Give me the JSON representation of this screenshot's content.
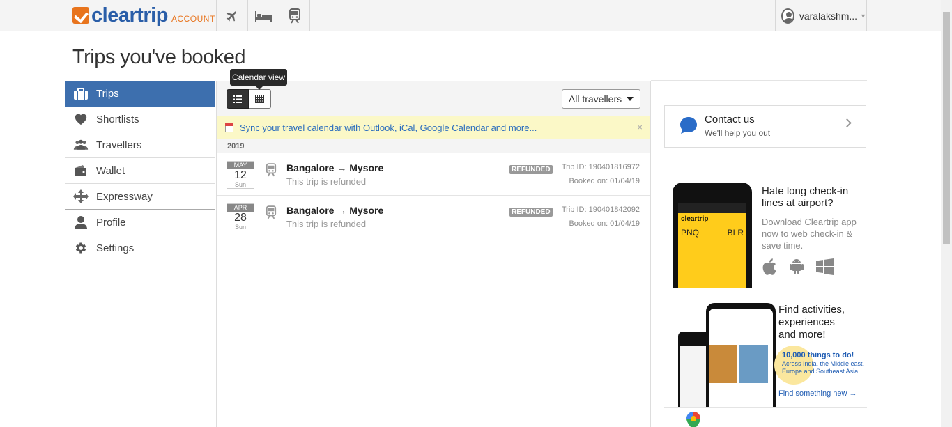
{
  "header": {
    "brand": "cleartrip",
    "brand_sub": "ACCOUNT",
    "nav": [
      {
        "icon": "airplane-icon"
      },
      {
        "icon": "bed-icon"
      },
      {
        "icon": "train-icon"
      }
    ],
    "user": "varalakshm..."
  },
  "page": {
    "title": "Trips you've booked"
  },
  "sidebar": {
    "items": [
      {
        "label": "Trips",
        "icon": "suitcase-icon"
      },
      {
        "label": "Shortlists",
        "icon": "heart-icon"
      },
      {
        "label": "Travellers",
        "icon": "people-icon"
      },
      {
        "label": "Wallet",
        "icon": "wallet-icon"
      },
      {
        "label": "Expressway",
        "icon": "expressway-icon"
      },
      {
        "label": "Profile",
        "icon": "person-icon"
      },
      {
        "label": "Settings",
        "icon": "gear-icon"
      }
    ]
  },
  "toolbar": {
    "tooltip": "Calendar view",
    "travellers": "All travellers"
  },
  "sync_banner": {
    "text": "Sync your travel calendar with Outlook, iCal, Google Calendar and more...",
    "close": "×"
  },
  "year": "2019",
  "trips": [
    {
      "month": "MAY",
      "day": "12",
      "weekday": "Sun",
      "route": "Bangalore → Mysore",
      "status": "This trip is refunded",
      "badge": "REFUNDED",
      "trip_id": "Trip ID: 190401816972",
      "booked": "Booked on: 01/04/19"
    },
    {
      "month": "APR",
      "day": "28",
      "weekday": "Sun",
      "route": "Bangalore → Mysore",
      "status": "This trip is refunded",
      "badge": "REFUNDED",
      "trip_id": "Trip ID: 190401842092",
      "booked": "Booked on: 01/04/19"
    }
  ],
  "contact": {
    "title": "Contact us",
    "subtitle": "We'll help you out"
  },
  "promo_app": {
    "heading": "Hate long check-in lines at airport?",
    "body": "Download Cleartrip app now to web check-in & save time.",
    "phone_brand": "cleartrip",
    "from": "PNQ",
    "to": "BLR"
  },
  "promo_activities": {
    "heading_line1": "Find activities,",
    "heading_line2": "experiences",
    "heading_line3": "and more!",
    "count": "10,000 things to do!",
    "regions": "Across India, the Middle east, Europe and Southeast Asia.",
    "link": "Find something new →"
  },
  "colors": {
    "brand_orange": "#e8741d",
    "brand_blue": "#2a5ea8",
    "active_blue": "#3d6fae",
    "link_blue": "#2a6cbd"
  }
}
